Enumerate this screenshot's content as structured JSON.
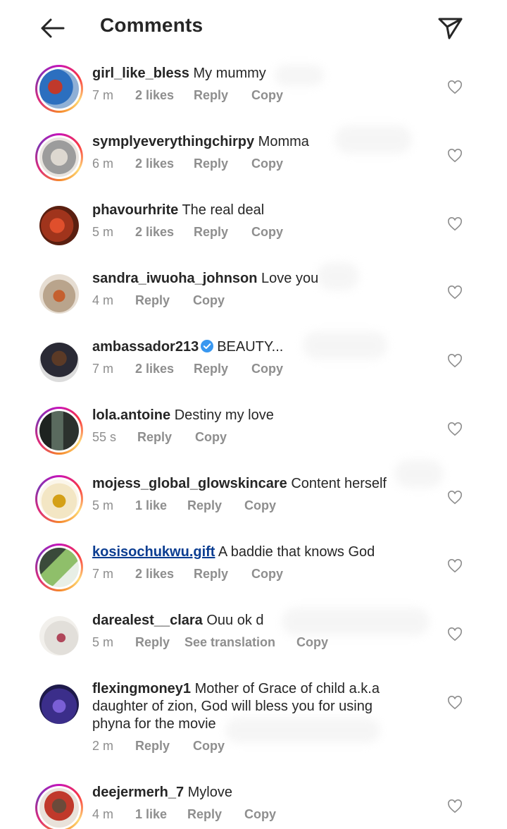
{
  "header": {
    "title": "Comments",
    "back_icon": "arrow-left-icon",
    "send_icon": "paper-plane-icon"
  },
  "colors": {
    "text": "#262626",
    "meta": "#8e8e8e",
    "verified": "#3897f0",
    "story_ring": "#dd2a7b"
  },
  "comments": [
    {
      "username": "girl_like_bless",
      "text": "My mummy",
      "time": "7 m",
      "likes": "2 likes",
      "reply": "Reply",
      "copy": "Copy"
    },
    {
      "username": "symplyeverythingchirpy",
      "text": "Momma",
      "time": "6 m",
      "likes": "2 likes",
      "reply": "Reply",
      "copy": "Copy"
    },
    {
      "username": "phavourhrite",
      "text": "The real deal",
      "time": "5 m",
      "likes": "2 likes",
      "reply": "Reply",
      "copy": "Copy"
    },
    {
      "username": "sandra_iwuoha_johnson",
      "text": "Love you",
      "time": "4 m",
      "reply": "Reply",
      "copy": "Copy"
    },
    {
      "username": "ambassador213",
      "text": "BEAUTY...",
      "time": "7 m",
      "likes": "2 likes",
      "reply": "Reply",
      "copy": "Copy",
      "verified": true
    },
    {
      "username": "lola.antoine",
      "text": "Destiny my love",
      "time": "55 s",
      "reply": "Reply",
      "copy": "Copy"
    },
    {
      "username": "mojess_global_glowskincare",
      "text": "Content herself",
      "time": "5 m",
      "likes": "1 like",
      "reply": "Reply",
      "copy": "Copy"
    },
    {
      "username": "kosisochukwu.gift",
      "text": "A baddie that knows God",
      "time": "7 m",
      "likes": "2 likes",
      "reply": "Reply",
      "copy": "Copy"
    },
    {
      "username": "darealest__clara",
      "text": "Ouu ok d",
      "time": "5 m",
      "reply": "Reply",
      "translate": "See translation",
      "copy": "Copy"
    },
    {
      "username": "flexingmoney1",
      "text_lines": [
        "Mother of Grace of child a.k.a",
        "daughter of zion, God will bless you for using",
        "phyna for the movie"
      ],
      "time": "2 m",
      "reply": "Reply",
      "copy": "Copy"
    },
    {
      "username": "deejermerh_7",
      "text": "Mylove",
      "time": "4 m",
      "likes": "1 like",
      "reply": "Reply",
      "copy": "Copy"
    }
  ]
}
